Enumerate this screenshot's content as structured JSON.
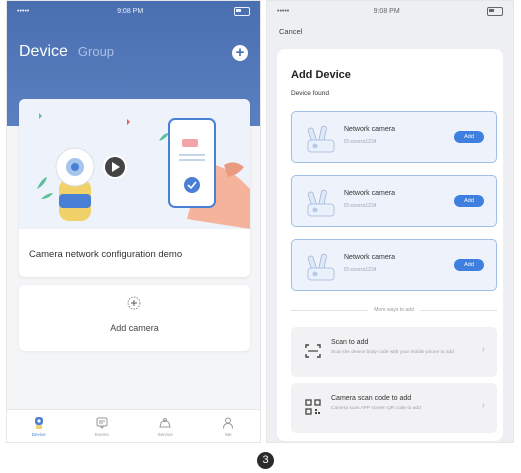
{
  "left_screen": {
    "status": {
      "time": "9:08 PM",
      "battery": "",
      "signal": "•••••"
    },
    "tabs": [
      {
        "label": "Device",
        "active": true
      },
      {
        "label": "Group",
        "active": false
      }
    ],
    "demo_card": {
      "label": "Camera network configuration demo"
    },
    "add_card": {
      "label": "Add camera"
    },
    "bottom_nav": [
      {
        "label": "Device",
        "icon": "device-icon",
        "active": true
      },
      {
        "label": "Events",
        "icon": "events-icon",
        "active": false
      },
      {
        "label": "Service",
        "icon": "service-icon",
        "active": false
      },
      {
        "label": "Me",
        "icon": "me-icon",
        "active": false
      }
    ]
  },
  "right_screen": {
    "status": {
      "time": "9:08 PM",
      "battery": "",
      "signal": "•••••"
    },
    "cancel_label": "Cancel",
    "title": "Add Device",
    "subtitle": "Device found",
    "devices": [
      {
        "name": "Network camera",
        "id": "ID:xxxxxx1234",
        "add_label": "Add"
      },
      {
        "name": "Network camera",
        "id": "ID:xxxxxx1234",
        "add_label": "Add"
      },
      {
        "name": "Network camera",
        "id": "ID:xxxxxx1234",
        "add_label": "Add"
      }
    ],
    "more_ways_label": "More ways to add",
    "options": [
      {
        "title": "Scan to add",
        "desc": "Scan the device body code with your mobile phone to add",
        "icon": "scan-icon"
      },
      {
        "title": "Camera scan code to add",
        "desc": "Camera scan APP screen QR code to add",
        "icon": "qr-code-icon"
      }
    ]
  },
  "step_number": "3",
  "colors": {
    "primary_blue": "#3f7fe0",
    "header_blue": "#4a6fb0",
    "card_highlight": "#eef3fb"
  }
}
